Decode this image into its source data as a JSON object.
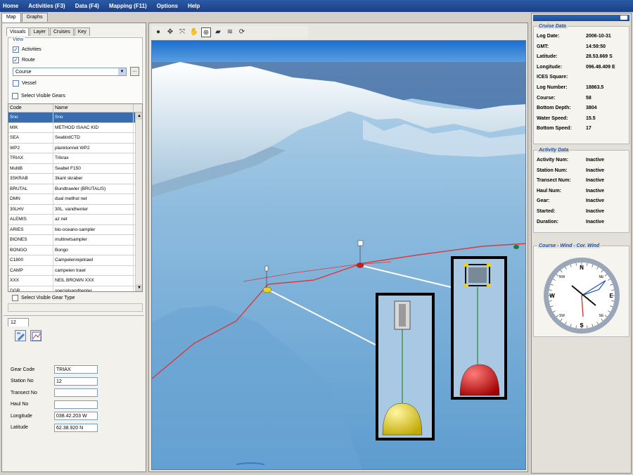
{
  "menu": [
    "Home",
    "Activities (F3)",
    "Data (F4)",
    "Mapping (F11)",
    "Options",
    "Help"
  ],
  "top_tabs": [
    "Map",
    "Graphs"
  ],
  "left_tabs": [
    "Visuals",
    "Layer",
    "Cruises",
    "Key"
  ],
  "view_group": {
    "label": "View",
    "activities": {
      "label": "Activities",
      "checked": true
    },
    "route": {
      "label": "Route",
      "checked": true
    },
    "route_select": "Course",
    "route_button": "...",
    "vessel": {
      "label": "Vessel",
      "checked": false
    }
  },
  "select_visible_gears": "Select Visible Gears",
  "gear_table": {
    "headers": [
      "Code",
      "Name"
    ],
    "rows": [
      [
        "Sno",
        "Sno"
      ],
      [
        "MIK",
        "METHOD ISAAC KID"
      ],
      [
        "SEA",
        "SeabirdCTD"
      ],
      [
        "WP2",
        "planktonnet WP2"
      ],
      [
        "TRIAX",
        "Trikrax"
      ],
      [
        "MultiB",
        "Seabel F150"
      ],
      [
        "3SKRAB",
        "3kant skraber"
      ],
      [
        "BRUTAL",
        "Bundtrawler (BRUTALIS)"
      ],
      [
        "DMN",
        "dual mellhol net"
      ],
      [
        "30LHV",
        "30L. vandhenter"
      ],
      [
        "ALEMIS",
        "az net"
      ],
      [
        "ARIES",
        "bio-oceano-sampler"
      ],
      [
        "BIONES",
        "multinetsampler"
      ],
      [
        "BONGO",
        "Bongo"
      ],
      [
        "C1800",
        "Campelenrejetrawl"
      ],
      [
        "CAMP",
        "campelen trawl"
      ],
      [
        "XXX",
        "NEIL BROWN XXX"
      ],
      [
        "DGR",
        "specialvandhenter"
      ]
    ]
  },
  "select_visible_gear_type": "Select Visible Gear Type",
  "detail": {
    "tab": "12",
    "fields": [
      {
        "label": "Gear Code",
        "value": "TRIAX"
      },
      {
        "label": "Station No",
        "value": "12"
      },
      {
        "label": "Transect No",
        "value": ""
      },
      {
        "label": "Haul No",
        "value": ""
      },
      {
        "label": "Longitude",
        "value": "038.42.203 W"
      },
      {
        "label": "Latitude",
        "value": "62.38.920 N"
      }
    ]
  },
  "cruise_data": {
    "title": "Cruise Data",
    "rows": [
      {
        "label": "Log Date:",
        "value": "2006-10-31"
      },
      {
        "label": "GMT:",
        "value": "14:59:50"
      },
      {
        "label": "Latitude:",
        "value": "28.53.669 S"
      },
      {
        "label": "Longitude:",
        "value": "096.48.409 E"
      },
      {
        "label": "ICES Square:",
        "value": ""
      },
      {
        "label": "Log Number:",
        "value": "18863.5"
      },
      {
        "label": "Course:",
        "value": "58"
      },
      {
        "label": "Bottom Depth:",
        "value": "3804"
      },
      {
        "label": "Water Speed:",
        "value": "15.5"
      },
      {
        "label": "Bottom Speed:",
        "value": "17"
      }
    ]
  },
  "activity_data": {
    "title": "Activity Data",
    "rows": [
      {
        "label": "Activity Num:",
        "value": "Inactive"
      },
      {
        "label": "Station Num:",
        "value": "Inactive"
      },
      {
        "label": "Transect Num:",
        "value": "Inactive"
      },
      {
        "label": "Haul Num:",
        "value": "Inactive"
      },
      {
        "label": "Gear:",
        "value": "Inactive"
      },
      {
        "label": "Started:",
        "value": "Inactive"
      },
      {
        "label": "Duration:",
        "value": "Inactive"
      }
    ]
  },
  "compass": {
    "title": "Course - Wind - Cor. Wind",
    "labels": {
      "N": "N",
      "S": "S",
      "E": "E",
      "W": "W",
      "NE": "NE",
      "NW": "NW",
      "SE": "SE",
      "SW": "SW"
    },
    "course_deg": 58,
    "colors": {
      "course": "#1d4fb0",
      "wind": "#d23a3a",
      "cor_wind": "#111111"
    }
  },
  "colors": {
    "menubar": "#1f4a96",
    "selection": "#3a6cb0",
    "sea": "#7fb1d9",
    "buoy_yellow": "#e8d21a",
    "buoy_red": "#d21a1a",
    "track": "#d83a3a"
  }
}
